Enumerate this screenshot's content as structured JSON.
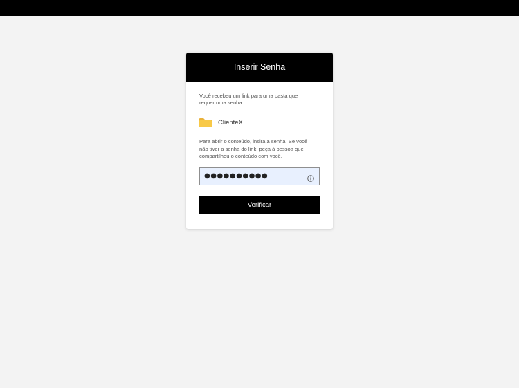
{
  "card": {
    "title": "Inserir Senha",
    "intro": "Você recebeu um link para uma pasta que requer uma senha.",
    "folder": {
      "icon": "folder-icon",
      "name": "ClienteX",
      "color": "#f8c948"
    },
    "instructions": "Para abrir o conteúdo, insira a senha. Se você não tiver a senha do link, peça à pessoa que compartilhou o conteúdo com você.",
    "password": {
      "value": "●●●●●●●●●●",
      "info_icon": "info-icon"
    },
    "verify_label": "Verificar"
  },
  "colors": {
    "header_bg": "#000000",
    "button_bg": "#000000",
    "field_bg": "#e8f0fe",
    "page_bg": "#f3f3f3"
  }
}
